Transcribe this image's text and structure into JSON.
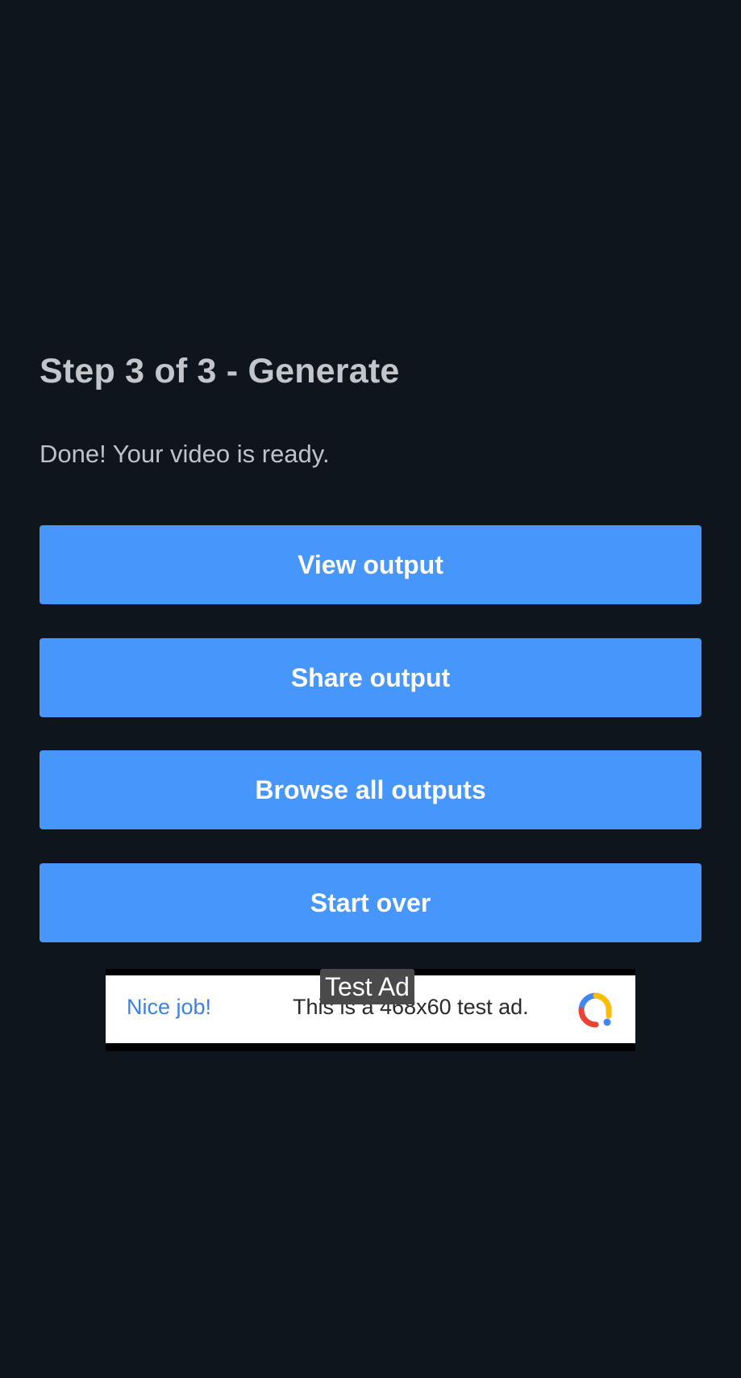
{
  "step": {
    "title": "Step 3 of 3 - Generate",
    "status": "Done! Your video is ready."
  },
  "actions": {
    "view_label": "View output",
    "share_label": "Share output",
    "browse_label": "Browse all outputs",
    "start_over_label": "Start over"
  },
  "ad": {
    "label": "Test Ad",
    "headline": "Nice job!",
    "body": "This is a 468x60 test ad.",
    "logo_icon": "admob-logo-icon"
  },
  "colors": {
    "background": "#0f151c",
    "button": "#4696fc",
    "ad_headline": "#3b82e6"
  }
}
